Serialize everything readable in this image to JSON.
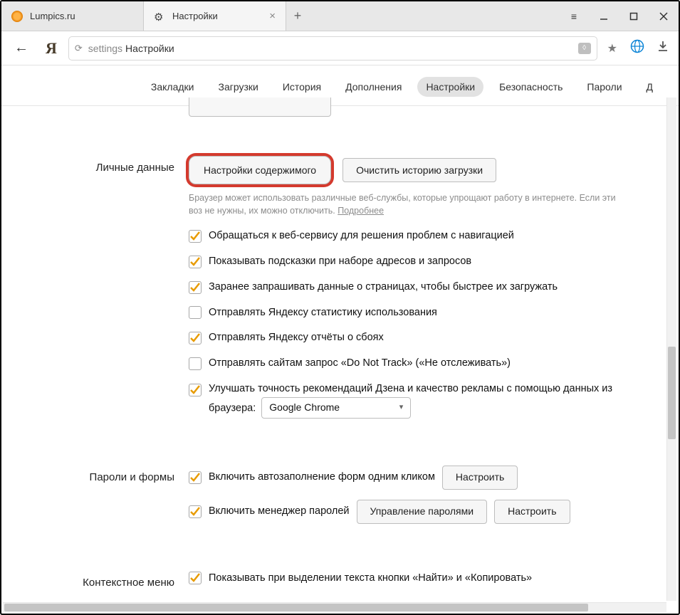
{
  "titlebar": {
    "tabs": [
      {
        "title": "Lumpics.ru",
        "active": false,
        "favicon": "lumpics"
      },
      {
        "title": "Настройки",
        "active": true,
        "favicon": "gear"
      }
    ],
    "newtab_label": "+"
  },
  "addr": {
    "url_path": "settings",
    "url_title": "Настройки"
  },
  "topnav": {
    "items": [
      {
        "label": "Закладки",
        "selected": false
      },
      {
        "label": "Загрузки",
        "selected": false
      },
      {
        "label": "История",
        "selected": false
      },
      {
        "label": "Дополнения",
        "selected": false
      },
      {
        "label": "Настройки",
        "selected": true
      },
      {
        "label": "Безопасность",
        "selected": false
      },
      {
        "label": "Пароли",
        "selected": false
      },
      {
        "label": "Д",
        "selected": false
      }
    ]
  },
  "sections": {
    "personal": {
      "title": "Личные данные",
      "content_settings_btn": "Настройки содержимого",
      "clear_history_btn": "Очистить историю загрузки",
      "helper_text": "Браузер может использовать различные веб-службы, которые упрощают работу в интернете. Если эти воз не нужны, их можно отключить. ",
      "helper_link": "Подробнее",
      "checks": [
        {
          "label": "Обращаться к веб-сервису для решения проблем с навигацией",
          "checked": true
        },
        {
          "label": "Показывать подсказки при наборе адресов и запросов",
          "checked": true
        },
        {
          "label": "Заранее запрашивать данные о страницах, чтобы быстрее их загружать",
          "checked": true
        },
        {
          "label": "Отправлять Яндексу статистику использования",
          "checked": false
        },
        {
          "label": "Отправлять Яндексу отчёты о сбоях",
          "checked": true
        },
        {
          "label": "Отправлять сайтам запрос «Do Not Track» («Не отслеживать»)",
          "checked": false
        }
      ],
      "zen_check": {
        "label_pre": "Улучшать точность рекомендаций Дзена и качество рекламы с помощью данных из браузера:",
        "checked": true
      },
      "browser_select": {
        "value": "Google Chrome"
      }
    },
    "passwords": {
      "title": "Пароли и формы",
      "autofill_check": {
        "label": "Включить автозаполнение форм одним кликом",
        "checked": true
      },
      "autofill_btn": "Настроить",
      "pwmgr_check": {
        "label": "Включить менеджер паролей",
        "checked": true
      },
      "pwmgr_btn1": "Управление паролями",
      "pwmgr_btn2": "Настроить"
    },
    "context": {
      "title": "Контекстное меню",
      "check": {
        "label": "Показывать при выделении текста кнопки «Найти» и «Копировать»",
        "checked": true
      }
    }
  }
}
